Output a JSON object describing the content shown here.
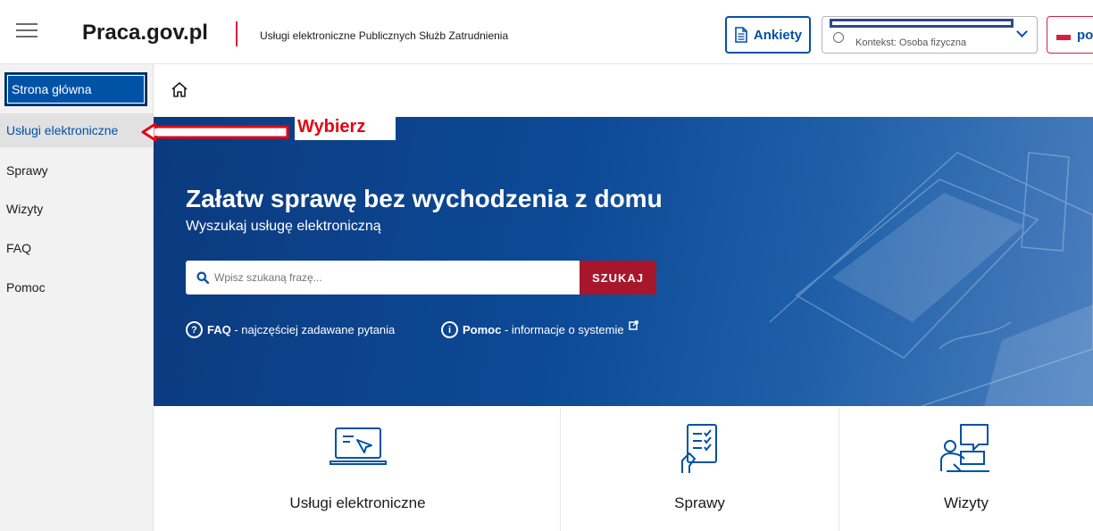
{
  "header": {
    "logo": "Praca.gov.pl",
    "subtitle": "Usługi elektroniczne Publicznych Służb Zatrudnienia",
    "ankiety_label": "Ankiety",
    "context_label": "Kontekst: Osoba fizyczna",
    "lang_label": "po"
  },
  "sidebar": {
    "items": [
      {
        "label": "Strona główna"
      },
      {
        "label": "Usługi elektroniczne"
      },
      {
        "label": "Sprawy"
      },
      {
        "label": "Wizyty"
      },
      {
        "label": "FAQ"
      },
      {
        "label": "Pomoc"
      }
    ]
  },
  "annotation": {
    "label": "Wybierz"
  },
  "hero": {
    "title": "Załatw sprawę bez wychodzenia z domu",
    "subtitle": "Wyszukaj usługę elektroniczną",
    "search_placeholder": "Wpisz szukaną frazę...",
    "search_button": "SZUKAJ",
    "faq_bold": "FAQ",
    "faq_rest": " - najczęściej zadawane pytania",
    "help_bold": "Pomoc",
    "help_rest": " - informacje o systemie"
  },
  "cards": [
    {
      "label": "Usługi elektroniczne",
      "icon": "laptop-cursor-icon"
    },
    {
      "label": "Sprawy",
      "icon": "checklist-hand-icon"
    },
    {
      "label": "Wizyty",
      "icon": "meeting-chat-icon"
    }
  ],
  "colors": {
    "brand_blue": "#0052a5",
    "brand_red": "#a7162a",
    "annotation_red": "#e30613"
  }
}
